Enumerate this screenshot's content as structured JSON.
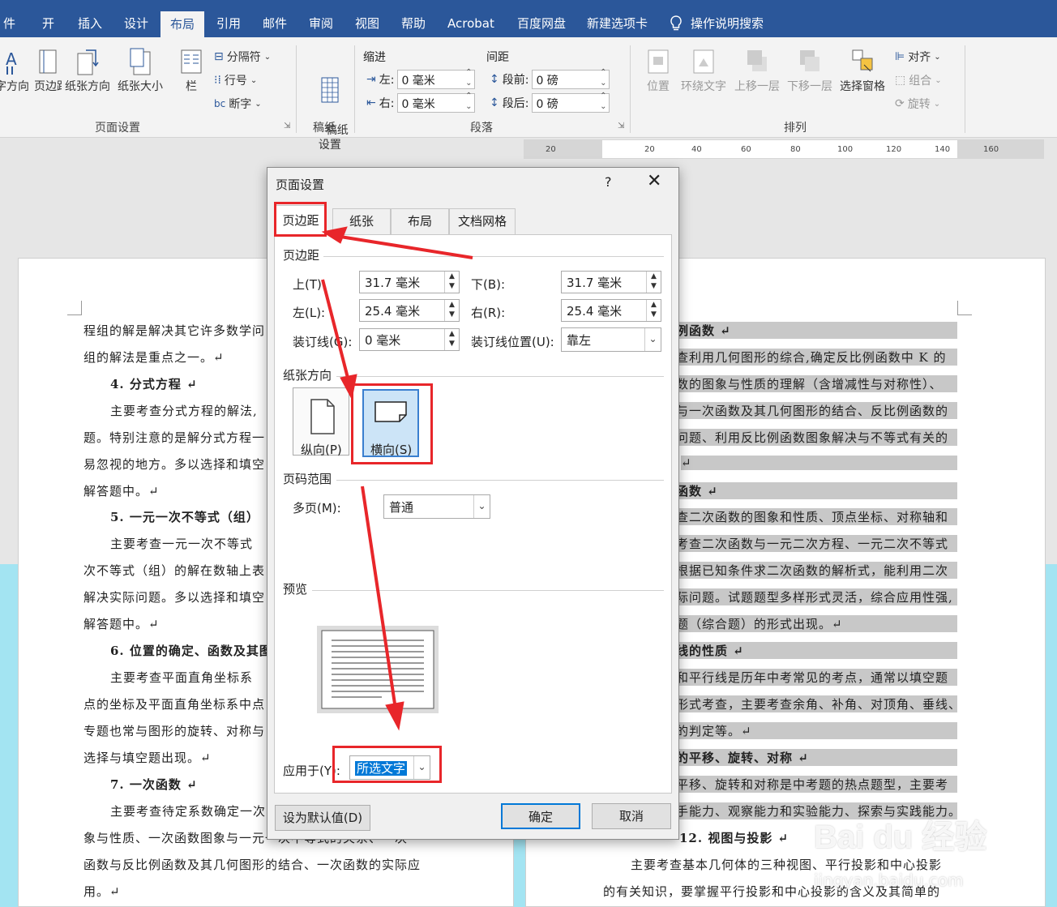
{
  "ribbon_tabs": [
    "件",
    "开",
    "插入",
    "设计",
    "布局",
    "引用",
    "邮件",
    "审阅",
    "视图",
    "帮助",
    "Acrobat",
    "百度网盘",
    "新建选项卡"
  ],
  "active_tab": "布局",
  "tell_me": "操作说明搜索",
  "ribbon": {
    "page_setup": {
      "label": "页面设置",
      "btn_direction": "字方向",
      "btn_margin": "页边距",
      "btn_orientation": "纸张方向",
      "btn_size": "纸张大小",
      "btn_columns": "栏",
      "btn_breaks": "分隔符",
      "btn_line_numbers": "行号",
      "btn_hyphenation": "断字"
    },
    "manuscript": {
      "label": "稿纸",
      "btn": "稿纸\n设置"
    },
    "paragraph": {
      "label": "段落",
      "indent_title": "缩进",
      "spacing_title": "间距",
      "left_label": "左:",
      "left_value": "0 毫米",
      "right_label": "右:",
      "right_value": "0 毫米",
      "before_label": "段前:",
      "before_value": "0 磅",
      "after_label": "段后:",
      "after_value": "0 磅"
    },
    "arrange": {
      "label": "排列",
      "position": "位置",
      "wrap_text": "环绕文字",
      "bring_forward": "上移一层",
      "send_backward": "下移一层",
      "selection_pane": "选择窗格",
      "align": "对齐",
      "group": "组合",
      "rotate": "旋转"
    }
  },
  "ruler_ticks": [
    "20",
    "20",
    "40",
    "60",
    "80",
    "100",
    "120",
    "140",
    "160"
  ],
  "doc_left": [
    "程组的解是解决其它许多数学问",
    "组的解法是重点之一。↵",
    "4. 分式方程 ↵",
    "主要考查分式方程的解法,",
    "题。特别注意的是解分式方程一",
    "易忽视的地方。多以选择和填空",
    "解答题中。↵",
    "5. 一元一次不等式（组）",
    "主要考查一元一次不等式",
    "次不等式（组）的解在数轴上表",
    "解决实际问题。多以选择和填空",
    "解答题中。↵",
    "6. 位置的确定、函数及其图",
    "主要考查平面直角坐标系",
    "点的坐标及平面直角坐标系中点",
    "专题也常与图形的旋转、对称与",
    "选择与填空题出现。↵",
    "7. 一次函数 ↵",
    "主要考查待定系数确定一次",
    "象与性质、一次函数图象与一元一次不等式的关系、一次",
    "函数与反比例函数及其几何图形的结合、一次函数的实际应",
    "用。↵"
  ],
  "doc_right": [
    "例函数 ↵",
    "查利用几何图形的综合,确定反比例函数中 K 的",
    "数的图象与性质的理解（含增减性与对称性）、",
    "与一次函数及其几何图形的结合、反比例函数的",
    "问题、利用反比例函数图象解决与不等式有关的",
    "↵",
    "函数 ↵",
    "查二次函数的图象和性质、顶点坐标、对称轴和",
    "考查二次函数与一元二次方程、一元二次不等式",
    "根据已知条件求二次函数的解析式，能利用二次",
    "际问题。试题题型多样形式灵活，综合应用性强,",
    "题（综合题）的形式出现。↵",
    "线的性质 ↵",
    "和平行线是历年中考常见的考点，通常以填空题",
    "形式考查，主要考查余角、补角、对顶角、垂线、",
    "的判定等。↵",
    "的平移、旋转、对称 ↵",
    "平移、旋转和对称是中考题的热点题型，主要考",
    "手能力、观察能力和实验能力、探索与实践能力。↵",
    "12. 视图与投影 ↵",
    "主要考查基本几何体的三种视图、平行投影和中心投影",
    "的有关知识，要掌握平行投影和中心投影的含义及其简单的"
  ],
  "dialog": {
    "title": "页面设置",
    "help": "?",
    "close": "✕",
    "tabs": [
      "页边距",
      "纸张",
      "布局",
      "文档网格"
    ],
    "margins_section": "页边距",
    "top_label": "上(T):",
    "top_value": "31.7 毫米",
    "bottom_label": "下(B):",
    "bottom_value": "31.7 毫米",
    "left_label": "左(L):",
    "left_value": "25.4 毫米",
    "right_label": "右(R):",
    "right_value": "25.4 毫米",
    "gutter_label": "装订线(G):",
    "gutter_value": "0 毫米",
    "gutter_pos_label": "装订线位置(U):",
    "gutter_pos_value": "靠左",
    "orientation_section": "纸张方向",
    "portrait": "纵向(P)",
    "landscape": "横向(S)",
    "pages_section": "页码范围",
    "multiple_pages_label": "多页(M):",
    "multiple_pages_value": "普通",
    "preview_section": "预览",
    "apply_to_label": "应用于(Y):",
    "apply_to_value": "所选文字",
    "set_default": "设为默认值(D)",
    "ok": "确定",
    "cancel": "取消"
  },
  "watermark": {
    "brand": "Bai du 经验",
    "url": "jingyan.baidu.com"
  },
  "colors": {
    "ribbon_blue": "#2b579a",
    "callout_red": "#e8262a",
    "selection_blue": "#0078d7",
    "backdrop_cyan": "#a3e4f2"
  }
}
